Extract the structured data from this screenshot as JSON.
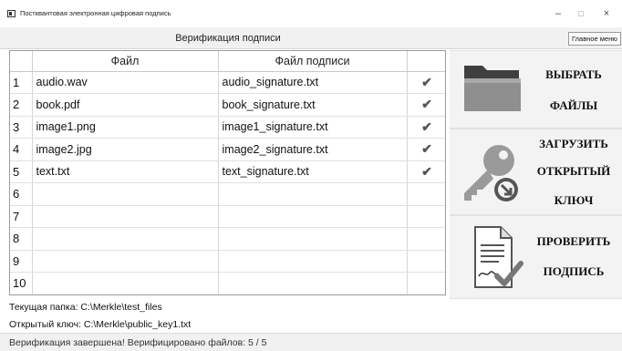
{
  "window": {
    "title": "Постквантовая электронная цифровая подпись",
    "minimize": "–",
    "maximize": "□",
    "close": "×"
  },
  "header": {
    "title": "Верификация подписи",
    "main_menu_label": "Главное меню"
  },
  "table": {
    "columns": [
      "",
      "Файл",
      "Файл подписи",
      ""
    ],
    "rows": [
      {
        "num": "1",
        "file": "audio.wav",
        "signature": "audio_signature.txt",
        "verified": "✔"
      },
      {
        "num": "2",
        "file": "book.pdf",
        "signature": "book_signature.txt",
        "verified": "✔"
      },
      {
        "num": "3",
        "file": "image1.png",
        "signature": "image1_signature.txt",
        "verified": "✔"
      },
      {
        "num": "4",
        "file": "image2.jpg",
        "signature": "image2_signature.txt",
        "verified": "✔"
      },
      {
        "num": "5",
        "file": "text.txt",
        "signature": "text_signature.txt",
        "verified": "✔"
      },
      {
        "num": "6",
        "file": "",
        "signature": "",
        "verified": ""
      },
      {
        "num": "7",
        "file": "",
        "signature": "",
        "verified": ""
      },
      {
        "num": "8",
        "file": "",
        "signature": "",
        "verified": ""
      },
      {
        "num": "9",
        "file": "",
        "signature": "",
        "verified": ""
      },
      {
        "num": "10",
        "file": "",
        "signature": "",
        "verified": ""
      }
    ]
  },
  "side_buttons": {
    "select_files": {
      "line1": "ВЫБРАТЬ",
      "line2": "ФАЙЛЫ",
      "icon": "folder-icon"
    },
    "load_key": {
      "line1": "ЗАГРУЗИТЬ",
      "line2": "ОТКРЫТЫЙ",
      "line3": "КЛЮЧ",
      "icon": "key-icon"
    },
    "verify": {
      "line1": "ПРОВЕРИТЬ",
      "line2": "ПОДПИСЬ",
      "icon": "signed-document-icon"
    }
  },
  "status": {
    "folder": "Текущая папка: C:\\Merkle\\test_files",
    "public_key": "Открытый ключ: C:\\Merkle\\public_key1.txt",
    "result": "Верификация завершена! Верифицировано файлов: 5 / 5"
  }
}
